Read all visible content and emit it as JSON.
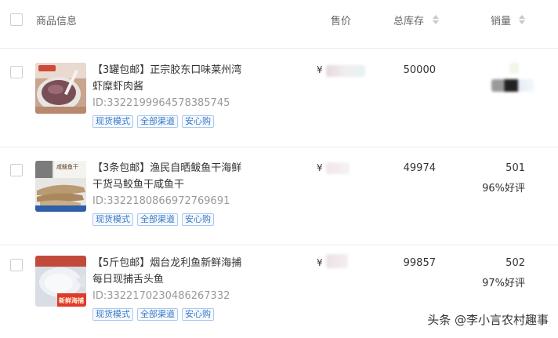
{
  "header": {
    "product_info": "商品信息",
    "price": "售价",
    "total_stock": "总库存",
    "sales": "销量"
  },
  "products": [
    {
      "title": "【3罐包邮】正宗胶东口味莱州湾虾糜虾肉酱",
      "id": "ID:3322199964578385745",
      "tags": [
        "现货模式",
        "全部渠道",
        "安心购"
      ],
      "price_symbol": "¥",
      "stock": "50000",
      "sales": "",
      "rating": ""
    },
    {
      "title": "【3条包邮】渔民自晒鲅鱼干海鲜干货马鲛鱼干咸鱼干",
      "id": "ID:3322180866972769691",
      "tags": [
        "现货模式",
        "全部渠道",
        "安心购"
      ],
      "price_symbol": "¥",
      "stock": "49974",
      "sales": "501",
      "rating": "96%好评"
    },
    {
      "title": "【5斤包邮】烟台龙利鱼新鲜海捕每日现捕舌头鱼",
      "id": "ID:3322170230486267332",
      "tags": [
        "现货模式",
        "全部渠道",
        "安心购"
      ],
      "price_symbol": "¥",
      "stock": "99857",
      "sales": "502",
      "rating": "97%好评"
    }
  ],
  "thumbnail_text": {
    "p2_label": "咸鲅鱼干",
    "p3_label": "新鲜海捕"
  },
  "watermark": "头条 @李小言农村趣事",
  "colors": {
    "tag_border": "#a9c9ee",
    "tag_text": "#3a79c7",
    "divider": "#ececec",
    "muted_text": "#999999"
  }
}
